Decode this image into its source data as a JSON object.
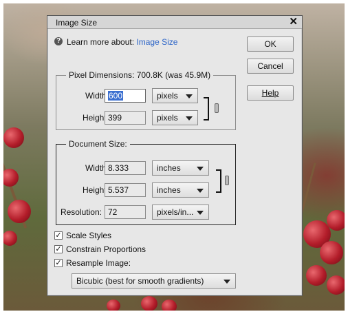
{
  "dialog": {
    "title": "Image Size",
    "close_glyph": "✕",
    "learn_prefix": "Learn more about:",
    "learn_link": "Image Size"
  },
  "buttons": {
    "ok": "OK",
    "cancel": "Cancel",
    "help": "Help"
  },
  "pixel_dimensions": {
    "legend": "Pixel Dimensions:",
    "size_info": "700.8K (was 45.9M)",
    "width_label": "Width:",
    "width_value": "600",
    "width_unit": "pixels",
    "height_label": "Height:",
    "height_value": "399",
    "height_unit": "pixels"
  },
  "document_size": {
    "legend": "Document Size:",
    "width_label": "Width:",
    "width_value": "8.333",
    "width_unit": "inches",
    "height_label": "Height:",
    "height_value": "5.537",
    "height_unit": "inches",
    "resolution_label": "Resolution:",
    "resolution_value": "72",
    "resolution_unit": "pixels/in..."
  },
  "options": {
    "scale_styles": {
      "label": "Scale Styles",
      "checked": true
    },
    "constrain_proportions": {
      "label": "Constrain Proportions",
      "checked": true
    },
    "resample_image": {
      "label": "Resample Image:",
      "checked": true
    },
    "resample_method": "Bicubic (best for smooth gradients)"
  },
  "colors": {
    "link": "#2a63c7",
    "selection": "#3b6fd0",
    "dialog_bg": "#e7e7e7"
  },
  "icons": {
    "help_icon": "question-circle",
    "close_icon": "x",
    "check_icon": "checkmark",
    "link_icon": "chain-link"
  }
}
